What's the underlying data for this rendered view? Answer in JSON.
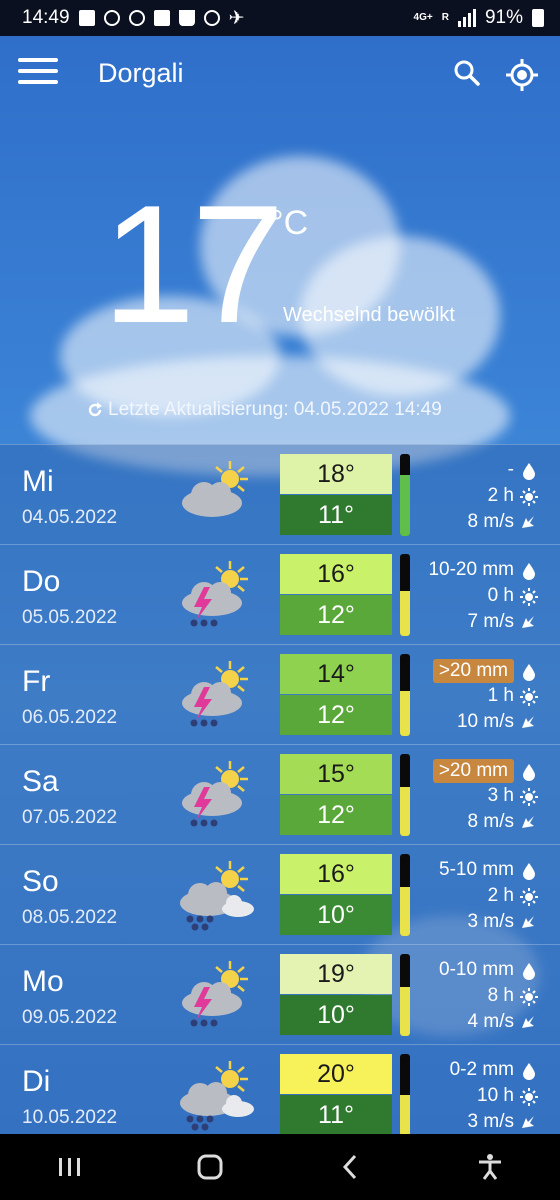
{
  "status_bar": {
    "time": "14:49",
    "network": "4G+",
    "signal_label": "R",
    "battery": "91%"
  },
  "header": {
    "city": "Dorgali"
  },
  "current": {
    "temperature": "17",
    "unit": "°C",
    "condition": "Wechselnd bewölkt",
    "updated": "Letzte Aktualisierung: 04.05.2022 14:49"
  },
  "forecast": [
    {
      "day": "Mi",
      "date": "04.05.2022",
      "icon": "sun-cloud-icon",
      "max": "18°",
      "min": "11°",
      "max_color": "#dff3a8",
      "min_color": "#2f7a2f",
      "gauge_color": "#5fbf4a",
      "gauge_level": 0.75,
      "precip": "-",
      "precip_badge": false,
      "sun": "2 h",
      "wind": "8 m/s"
    },
    {
      "day": "Do",
      "date": "05.05.2022",
      "icon": "thunder-rain-icon",
      "max": "16°",
      "min": "12°",
      "max_color": "#c9f26a",
      "min_color": "#5aa83a",
      "gauge_color": "#e8e34a",
      "gauge_level": 0.55,
      "precip": "10-20 mm",
      "precip_badge": false,
      "sun": "0 h",
      "wind": "7 m/s"
    },
    {
      "day": "Fr",
      "date": "06.05.2022",
      "icon": "thunder-rain-icon",
      "max": "14°",
      "min": "12°",
      "max_color": "#8fd24f",
      "min_color": "#5aa83a",
      "gauge_color": "#e8e34a",
      "gauge_level": 0.55,
      "precip": ">20 mm",
      "precip_badge": true,
      "sun": "1 h",
      "wind": "10 m/s"
    },
    {
      "day": "Sa",
      "date": "07.05.2022",
      "icon": "thunder-rain-icon",
      "max": "15°",
      "min": "12°",
      "max_color": "#a4dc55",
      "min_color": "#5aa83a",
      "gauge_color": "#e8e34a",
      "gauge_level": 0.6,
      "precip": ">20 mm",
      "precip_badge": true,
      "sun": "3 h",
      "wind": "8 m/s"
    },
    {
      "day": "So",
      "date": "08.05.2022",
      "icon": "cloud-rain-icon",
      "max": "16°",
      "min": "10°",
      "max_color": "#c9f26a",
      "min_color": "#3b8a34",
      "gauge_color": "#e8e34a",
      "gauge_level": 0.6,
      "precip": "5-10 mm",
      "precip_badge": false,
      "sun": "2 h",
      "wind": "3 m/s"
    },
    {
      "day": "Mo",
      "date": "09.05.2022",
      "icon": "thunder-rain-icon",
      "max": "19°",
      "min": "10°",
      "max_color": "#e4f3b2",
      "min_color": "#2f7a2f",
      "gauge_color": "#e8e34a",
      "gauge_level": 0.6,
      "precip": "0-10 mm",
      "precip_badge": false,
      "sun": "8 h",
      "wind": "4 m/s"
    },
    {
      "day": "Di",
      "date": "10.05.2022",
      "icon": "cloud-rain-icon",
      "max": "20°",
      "min": "11°",
      "max_color": "#f7f25a",
      "min_color": "#2f7a2f",
      "gauge_color": "#e8e34a",
      "gauge_level": 0.5,
      "precip": "0-2 mm",
      "precip_badge": false,
      "sun": "10 h",
      "wind": "3 m/s"
    }
  ]
}
